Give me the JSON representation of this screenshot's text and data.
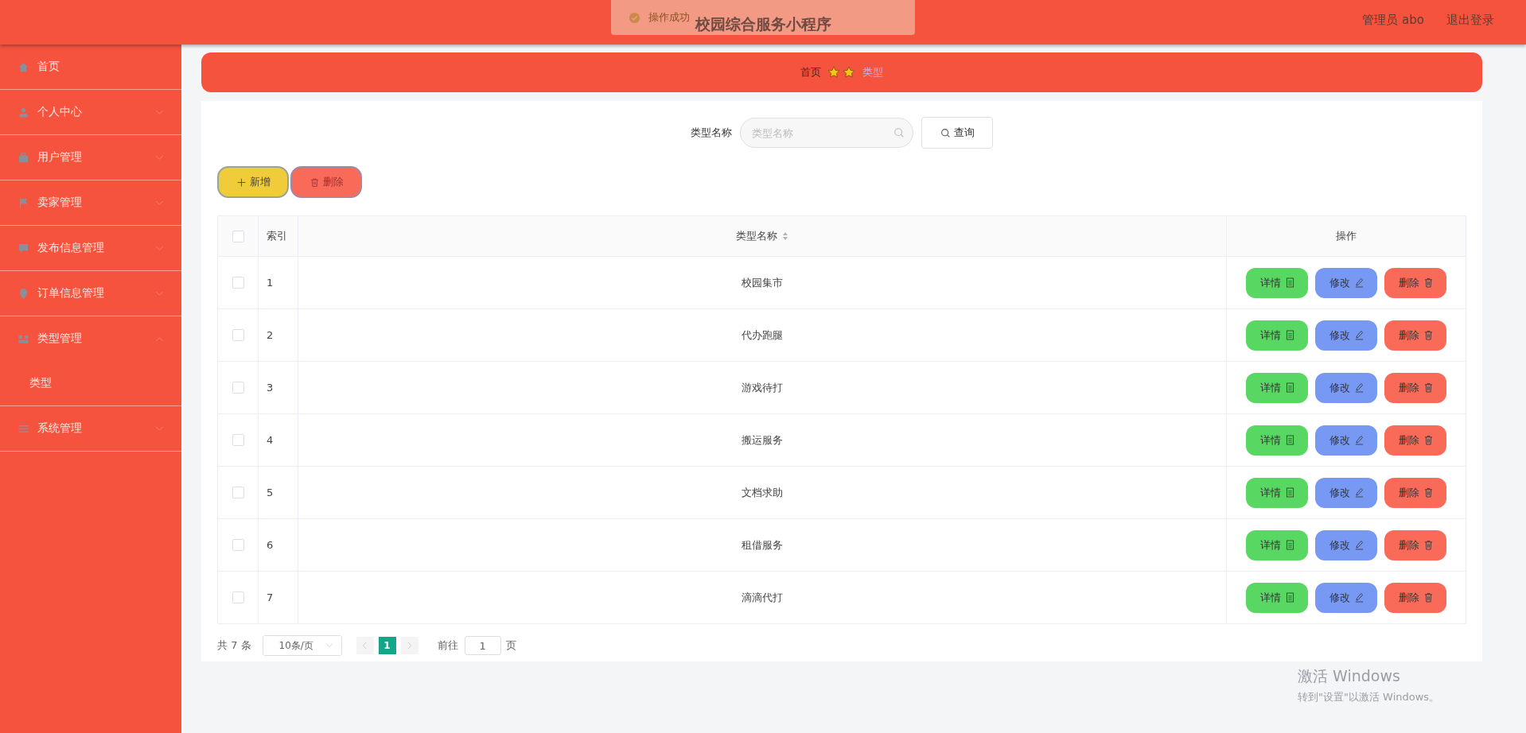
{
  "header": {
    "title": "校园综合服务小程序",
    "user": "管理员 abo",
    "logout": "退出登录"
  },
  "toast": {
    "text": "操作成功"
  },
  "sidebar": {
    "items": [
      {
        "label": "首页",
        "kind": "link"
      },
      {
        "label": "个人中心",
        "kind": "menu",
        "expanded": false
      },
      {
        "label": "用户管理",
        "kind": "menu",
        "expanded": false
      },
      {
        "label": "卖家管理",
        "kind": "menu",
        "expanded": false
      },
      {
        "label": "发布信息管理",
        "kind": "menu",
        "expanded": false
      },
      {
        "label": "订单信息管理",
        "kind": "menu",
        "expanded": false
      },
      {
        "label": "类型管理",
        "kind": "menu",
        "expanded": true,
        "children": [
          {
            "label": "类型"
          }
        ]
      },
      {
        "label": "系统管理",
        "kind": "menu",
        "expanded": false
      }
    ]
  },
  "breadcrumb": [
    "首页",
    "类型"
  ],
  "search": {
    "label": "类型名称",
    "placeholder": "类型名称",
    "button": "查询"
  },
  "actions": [
    {
      "label": "新增",
      "kind": "add"
    },
    {
      "label": "删除",
      "kind": "delete"
    }
  ],
  "table": {
    "columns": [
      "索引",
      "类型名称",
      "操作"
    ],
    "all_checked": false,
    "rows": [
      {
        "index": "1",
        "name": "校园集市",
        "checked": false,
        "buttons": [
          {
            "label": "详情",
            "kind": "detail"
          },
          {
            "label": "修改",
            "kind": "edit"
          },
          {
            "label": "删除",
            "kind": "delete"
          }
        ]
      },
      {
        "index": "2",
        "name": "代办跑腿",
        "checked": false,
        "buttons": [
          {
            "label": "详情",
            "kind": "detail"
          },
          {
            "label": "修改",
            "kind": "edit"
          },
          {
            "label": "删除",
            "kind": "delete"
          }
        ]
      },
      {
        "index": "3",
        "name": "游戏待打",
        "checked": false,
        "buttons": [
          {
            "label": "详情",
            "kind": "detail"
          },
          {
            "label": "修改",
            "kind": "edit"
          },
          {
            "label": "删除",
            "kind": "delete"
          }
        ]
      },
      {
        "index": "4",
        "name": "搬运服务",
        "checked": false,
        "buttons": [
          {
            "label": "详情",
            "kind": "detail"
          },
          {
            "label": "修改",
            "kind": "edit"
          },
          {
            "label": "删除",
            "kind": "delete"
          }
        ]
      },
      {
        "index": "5",
        "name": "文档求助",
        "checked": false,
        "buttons": [
          {
            "label": "详情",
            "kind": "detail"
          },
          {
            "label": "修改",
            "kind": "edit"
          },
          {
            "label": "删除",
            "kind": "delete"
          }
        ]
      },
      {
        "index": "6",
        "name": "租借服务",
        "checked": false,
        "buttons": [
          {
            "label": "详情",
            "kind": "detail"
          },
          {
            "label": "修改",
            "kind": "edit"
          },
          {
            "label": "删除",
            "kind": "delete"
          }
        ]
      },
      {
        "index": "7",
        "name": "滴滴代打",
        "checked": false,
        "buttons": [
          {
            "label": "详情",
            "kind": "detail"
          },
          {
            "label": "修改",
            "kind": "edit"
          },
          {
            "label": "删除",
            "kind": "delete"
          }
        ]
      }
    ]
  },
  "pagination": {
    "total": "共 7 条",
    "page_size": "10条/页",
    "pages": [
      {
        "label": "1",
        "selected": true
      }
    ],
    "goto_label": "前往",
    "goto_value": "1",
    "page_unit": "页"
  },
  "os_notice": {
    "title": "激活 Windows",
    "text": "转到\"设置\"以激活 Windows。"
  }
}
